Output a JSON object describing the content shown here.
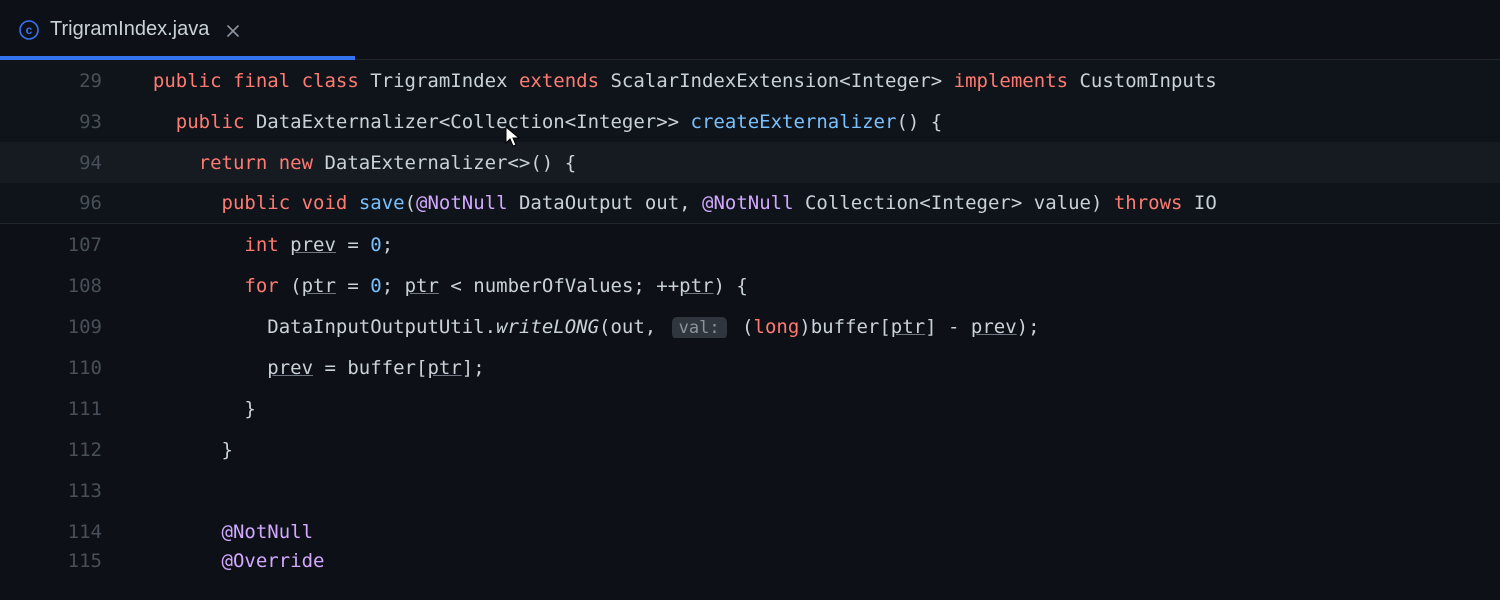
{
  "tab": {
    "title": "TrigramIndex.java",
    "icon": "java-class-icon"
  },
  "lines": [
    {
      "n": "29",
      "sticky": true,
      "tokens": [
        {
          "t": "indent",
          "v": "  "
        },
        {
          "t": "kw",
          "v": "public final class"
        },
        {
          "t": "plain",
          "v": " TrigramIndex "
        },
        {
          "t": "kw",
          "v": "extends"
        },
        {
          "t": "plain",
          "v": " ScalarIndexExtension<Integer> "
        },
        {
          "t": "kw",
          "v": "implements"
        },
        {
          "t": "plain",
          "v": " CustomInputs"
        }
      ]
    },
    {
      "n": "93",
      "sticky": true,
      "tokens": [
        {
          "t": "indent",
          "v": "    "
        },
        {
          "t": "kw",
          "v": "public"
        },
        {
          "t": "plain",
          "v": " DataExternalizer<Collection<Integer>> "
        },
        {
          "t": "fn",
          "v": "createExternalizer"
        },
        {
          "t": "plain",
          "v": "() {"
        }
      ]
    },
    {
      "n": "94",
      "sticky": true,
      "highlight": true,
      "tokens": [
        {
          "t": "indent",
          "v": "      "
        },
        {
          "t": "kw",
          "v": "return new"
        },
        {
          "t": "plain",
          "v": " DataExternalizer<>() {"
        }
      ]
    },
    {
      "n": "96",
      "sticky": true,
      "last_sticky": true,
      "tokens": [
        {
          "t": "indent",
          "v": "        "
        },
        {
          "t": "kw",
          "v": "public void"
        },
        {
          "t": "plain",
          "v": " "
        },
        {
          "t": "fn",
          "v": "save"
        },
        {
          "t": "plain",
          "v": "("
        },
        {
          "t": "anno",
          "v": "@NotNull"
        },
        {
          "t": "plain",
          "v": " DataOutput out, "
        },
        {
          "t": "anno",
          "v": "@NotNull"
        },
        {
          "t": "plain",
          "v": " Collection<Integer> value) "
        },
        {
          "t": "kw",
          "v": "throws"
        },
        {
          "t": "plain",
          "v": " IO"
        }
      ]
    },
    {
      "n": "107",
      "tokens": [
        {
          "t": "indent",
          "v": "          "
        },
        {
          "t": "kw",
          "v": "int"
        },
        {
          "t": "plain",
          "v": " "
        },
        {
          "t": "under",
          "v": "prev"
        },
        {
          "t": "plain",
          "v": " = "
        },
        {
          "t": "num",
          "v": "0"
        },
        {
          "t": "plain",
          "v": ";"
        }
      ]
    },
    {
      "n": "108",
      "tokens": [
        {
          "t": "indent",
          "v": "          "
        },
        {
          "t": "kw",
          "v": "for"
        },
        {
          "t": "plain",
          "v": " ("
        },
        {
          "t": "under",
          "v": "ptr"
        },
        {
          "t": "plain",
          "v": " = "
        },
        {
          "t": "num",
          "v": "0"
        },
        {
          "t": "plain",
          "v": "; "
        },
        {
          "t": "under",
          "v": "ptr"
        },
        {
          "t": "plain",
          "v": " < numberOfValues; ++"
        },
        {
          "t": "under",
          "v": "ptr"
        },
        {
          "t": "plain",
          "v": ") {"
        }
      ]
    },
    {
      "n": "109",
      "tokens": [
        {
          "t": "indent",
          "v": "            "
        },
        {
          "t": "plain",
          "v": "DataInputOutputUtil."
        },
        {
          "t": "italic",
          "v": "writeLONG"
        },
        {
          "t": "plain",
          "v": "(out, "
        },
        {
          "t": "hint",
          "v": "val:"
        },
        {
          "t": "plain",
          "v": " ("
        },
        {
          "t": "kw",
          "v": "long"
        },
        {
          "t": "plain",
          "v": ")buffer["
        },
        {
          "t": "under",
          "v": "ptr"
        },
        {
          "t": "plain",
          "v": "] - "
        },
        {
          "t": "under",
          "v": "prev"
        },
        {
          "t": "plain",
          "v": ");"
        }
      ]
    },
    {
      "n": "110",
      "tokens": [
        {
          "t": "indent",
          "v": "            "
        },
        {
          "t": "under",
          "v": "prev"
        },
        {
          "t": "plain",
          "v": " = buffer["
        },
        {
          "t": "under",
          "v": "ptr"
        },
        {
          "t": "plain",
          "v": "];"
        }
      ]
    },
    {
      "n": "111",
      "tokens": [
        {
          "t": "indent",
          "v": "          "
        },
        {
          "t": "plain",
          "v": "}"
        }
      ]
    },
    {
      "n": "112",
      "tokens": [
        {
          "t": "indent",
          "v": "        "
        },
        {
          "t": "plain",
          "v": "}"
        }
      ]
    },
    {
      "n": "113",
      "tokens": []
    },
    {
      "n": "114",
      "tokens": [
        {
          "t": "indent",
          "v": "        "
        },
        {
          "t": "anno",
          "v": "@NotNull"
        }
      ]
    },
    {
      "n": "115",
      "partial": true,
      "tokens": [
        {
          "t": "indent",
          "v": "        "
        },
        {
          "t": "anno",
          "v": "@Override"
        }
      ]
    }
  ]
}
